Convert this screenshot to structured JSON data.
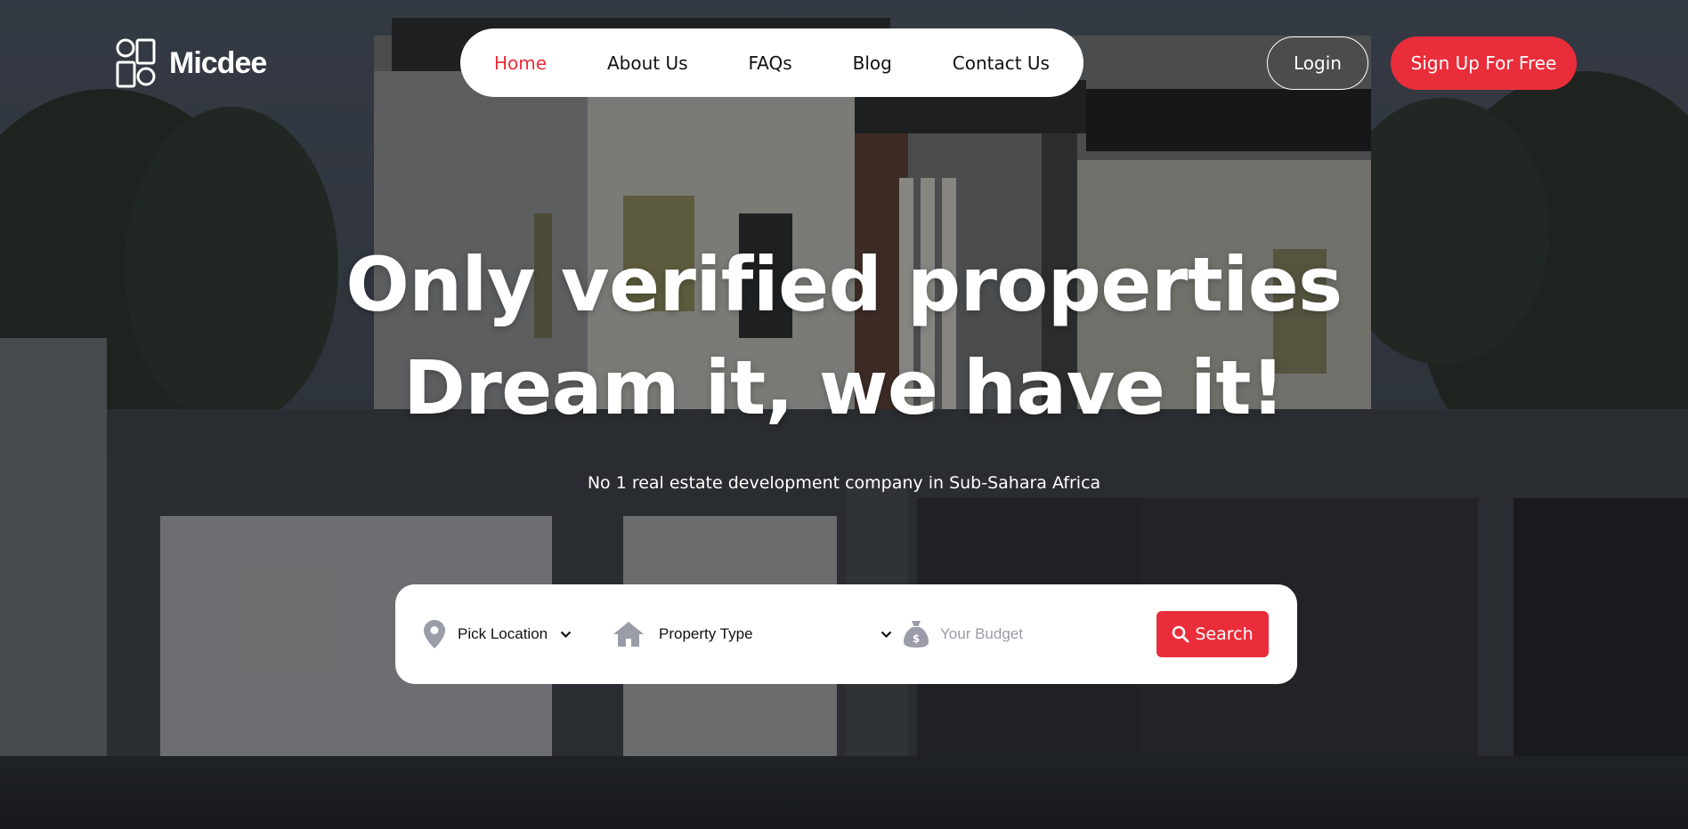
{
  "brand": {
    "name": "Micdee"
  },
  "nav": {
    "items": [
      {
        "label": "Home",
        "active": true
      },
      {
        "label": "About Us",
        "active": false
      },
      {
        "label": "FAQs",
        "active": false
      },
      {
        "label": "Blog",
        "active": false
      },
      {
        "label": "Contact Us",
        "active": false
      }
    ]
  },
  "auth": {
    "login_label": "Login",
    "signup_label": "Sign Up For Free"
  },
  "hero": {
    "headline_line1": "Only verified properties",
    "headline_line2": "Dream it, we have it!",
    "subtitle": "No 1 real estate development company in Sub-Sahara Africa"
  },
  "search": {
    "location_label": "Pick Location",
    "property_type_label": "Property Type",
    "budget_placeholder": "Your Budget",
    "button_label": "Search",
    "icons": {
      "location": "map-pin-icon",
      "property": "house-icon",
      "budget": "money-bag-icon",
      "search": "magnifier-icon"
    }
  },
  "colors": {
    "accent": "#ea2d3a",
    "icon_gray": "#9a9da8",
    "nav_bg": "#ffffff"
  }
}
